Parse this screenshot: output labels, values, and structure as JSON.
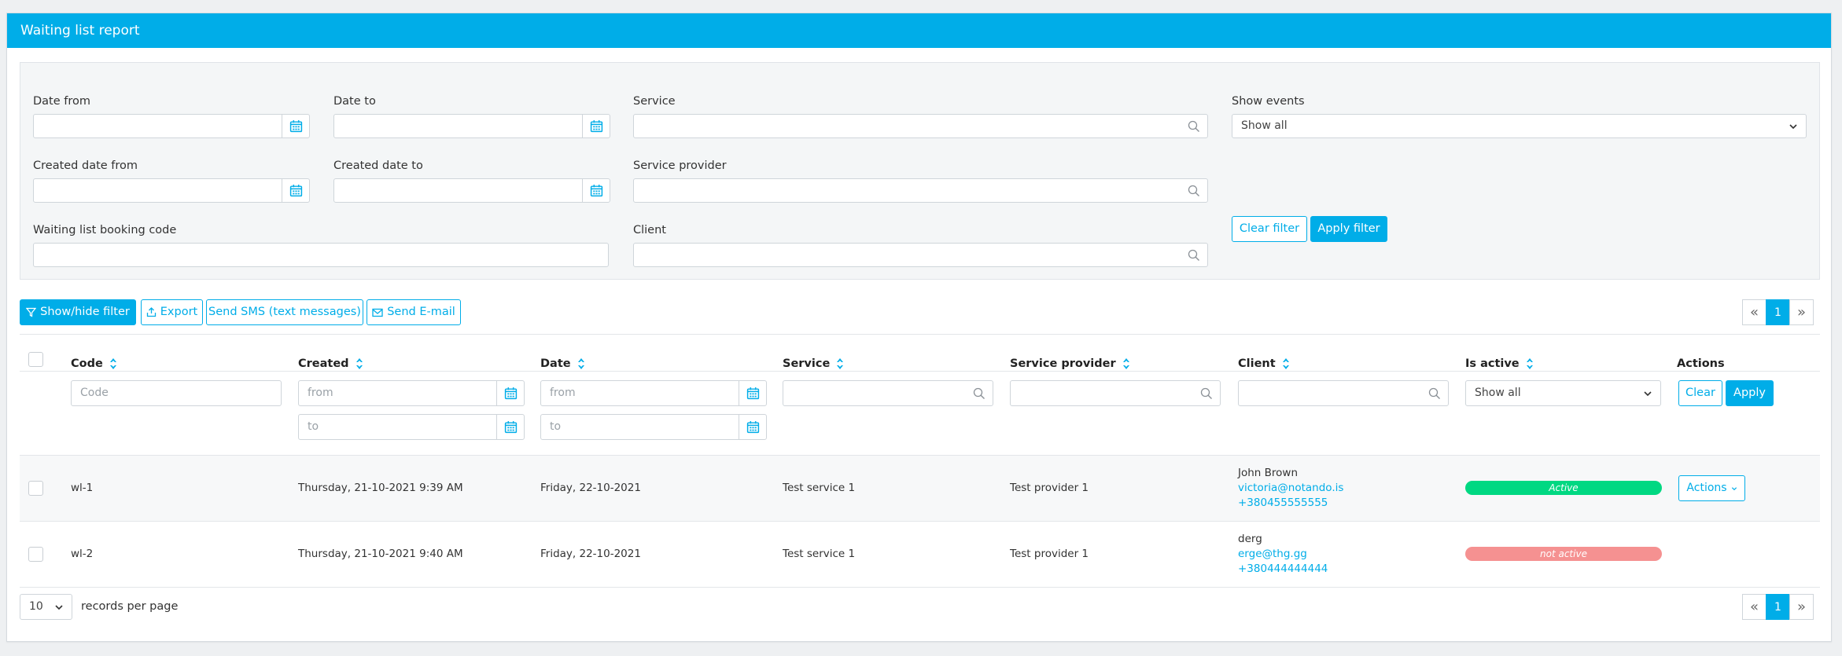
{
  "header": {
    "title": "Waiting list report"
  },
  "filters": {
    "date_from": {
      "label": "Date from",
      "value": ""
    },
    "date_to": {
      "label": "Date to",
      "value": ""
    },
    "service": {
      "label": "Service",
      "value": ""
    },
    "show_events": {
      "label": "Show events",
      "value": "Show all"
    },
    "created_date_from": {
      "label": "Created date from",
      "value": ""
    },
    "created_date_to": {
      "label": "Created date to",
      "value": ""
    },
    "service_provider": {
      "label": "Service provider",
      "value": ""
    },
    "booking_code": {
      "label": "Waiting list booking code",
      "value": ""
    },
    "client": {
      "label": "Client",
      "value": ""
    },
    "clear_label": "Clear filter",
    "apply_label": "Apply filter"
  },
  "toolbar": {
    "show_hide_filter": "Show/hide filter",
    "export": "Export",
    "send_sms": "Send SMS (text messages)",
    "send_email": "Send E-mail"
  },
  "pagination": {
    "prev": "«",
    "current": "1",
    "next": "»"
  },
  "table": {
    "columns": {
      "code": "Code",
      "created": "Created",
      "date": "Date",
      "service": "Service",
      "service_provider": "Service provider",
      "client": "Client",
      "is_active": "Is active",
      "actions": "Actions"
    },
    "column_filters": {
      "code_placeholder": "Code",
      "from_placeholder": "from",
      "to_placeholder": "to",
      "is_active_value": "Show all",
      "clear_label": "Clear",
      "apply_label": "Apply"
    },
    "rows": [
      {
        "code": "wl-1",
        "created": "Thursday, 21-10-2021 9:39 AM",
        "date": "Friday, 22-10-2021",
        "service": "Test service 1",
        "service_provider": "Test provider 1",
        "client_name": "John Brown",
        "client_email": "victoria@notando.is",
        "client_phone": "+380455555555",
        "status": "Active",
        "status_color": "#00d882",
        "actions_label": "Actions"
      },
      {
        "code": "wl-2",
        "created": "Thursday, 21-10-2021 9:40 AM",
        "date": "Friday, 22-10-2021",
        "service": "Test service 1",
        "service_provider": "Test provider 1",
        "client_name": "derg",
        "client_email": "erge@thg.gg",
        "client_phone": "+380444444444",
        "status": "not active",
        "status_color": "#f59191",
        "actions_label": ""
      }
    ]
  },
  "footer": {
    "per_page_value": "10",
    "per_page_label": "records per page"
  },
  "colors": {
    "accent": "#00ade8",
    "active": "#00d882",
    "inactive": "#f59191"
  }
}
